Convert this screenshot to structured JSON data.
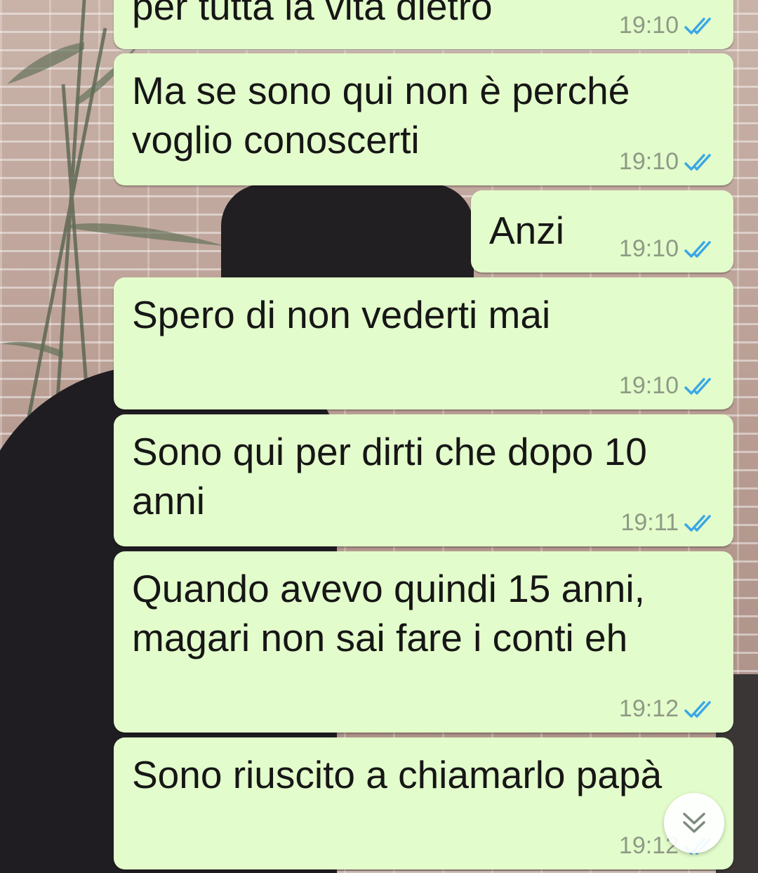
{
  "messages": [
    {
      "text": "per tutta la vita dietro",
      "time": "19:10",
      "status_icon": "double-check-read-icon"
    },
    {
      "text": "Ma se sono qui non è perché\nvoglio conoscerti",
      "time": "19:10",
      "status_icon": "double-check-read-icon"
    },
    {
      "text": "Anzi",
      "time": "19:10",
      "status_icon": "double-check-read-icon"
    },
    {
      "text": "Spero di non vederti mai",
      "time": "19:10",
      "status_icon": "double-check-read-icon"
    },
    {
      "text": "Sono qui per dirti che dopo 10\nanni",
      "time": "19:11",
      "status_icon": "double-check-read-icon"
    },
    {
      "text": "Quando avevo quindi 15 anni,\nmagari non sai fare i conti eh",
      "time": "19:12",
      "status_icon": "double-check-read-icon"
    },
    {
      "text": "Sono riuscito a chiamarlo papà",
      "time": "19:12",
      "status_icon": "double-check-read-icon"
    }
  ],
  "scroll_button": {
    "icon": "double-chevron-down-icon"
  },
  "colors": {
    "bubble_outgoing": "#e3fccb",
    "read_ticks": "#3ba7e6",
    "time_text": "#8e9a86"
  }
}
